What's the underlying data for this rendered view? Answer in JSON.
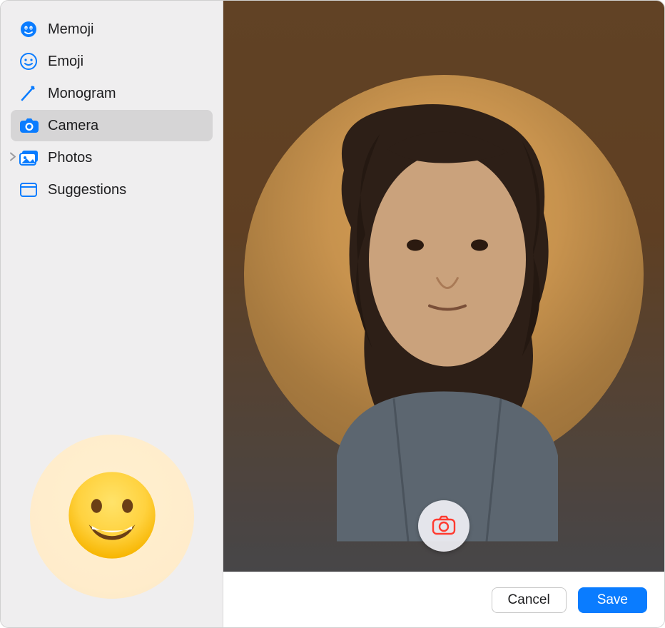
{
  "sidebar": {
    "items": [
      {
        "label": "Memoji",
        "icon": "memoji-icon",
        "selected": false
      },
      {
        "label": "Emoji",
        "icon": "emoji-icon",
        "selected": false
      },
      {
        "label": "Monogram",
        "icon": "monogram-icon",
        "selected": false
      },
      {
        "label": "Camera",
        "icon": "camera-icon",
        "selected": true
      },
      {
        "label": "Photos",
        "icon": "photos-icon",
        "selected": false,
        "expandable": true
      },
      {
        "label": "Suggestions",
        "icon": "suggestions-icon",
        "selected": false
      }
    ],
    "current_preview": {
      "type": "emoji",
      "name": "grinning-face"
    }
  },
  "main": {
    "capture_button_label": "Take Photo"
  },
  "footer": {
    "cancel_label": "Cancel",
    "save_label": "Save"
  },
  "colors": {
    "accent": "#0a7cff",
    "sidebar_bg": "#efeeef",
    "selected_bg": "#d6d5d6"
  }
}
